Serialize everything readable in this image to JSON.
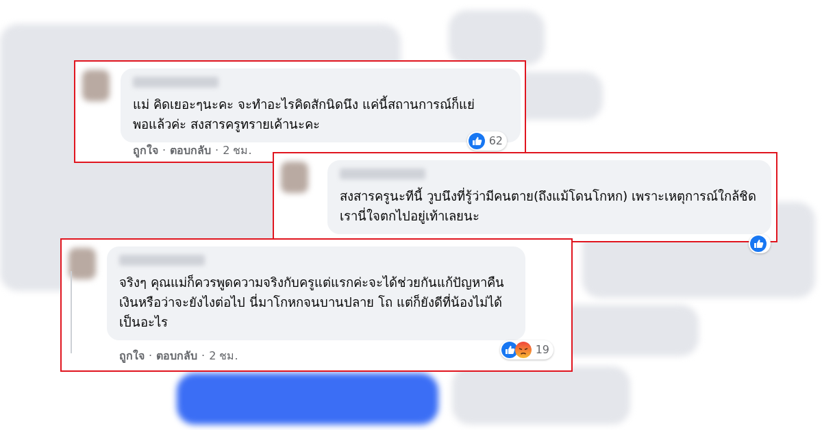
{
  "comments": [
    {
      "text": "แม่ คิดเยอะๆนะคะ จะทำอะไรคิดสักนิดนึง แค่นี้สถานการณ์ก็แย่พอแล้วค่ะ สงสารครูทรายเค้านะคะ",
      "actions": [
        "ถูกใจ",
        "ตอบกลับ"
      ],
      "separator": "·",
      "time": "2 ชม.",
      "reactions": [
        {
          "kind": "like"
        }
      ],
      "count": "62",
      "reply": false
    },
    {
      "text": "สงสารครูนะทีนี้ วูบนึงที่รู้ว่ามีคนตาย(ถึงแม้โดนโกหก) เพราะเหตุการณ์ใกล้ชิดเรานี่ใจตกไปอยู่เท้าเลยนะ",
      "reactions": [
        {
          "kind": "like"
        }
      ],
      "reply": false
    },
    {
      "text": "จริงๆ คุณแม่ก็ควรพูดความจริงกับครูแต่แรกค่ะจะได้ช่วยกันแก้ปัญหาคืนเงินหรือว่าจะยังไงต่อไป นี่มาโกหกจนบานปลาย โถ แต่ก็ยังดีที่น้องไม่ได้เป็นอะไร",
      "actions": [
        "ถูกใจ",
        "ตอบกลับ"
      ],
      "separator": "·",
      "time": "2 ชม.",
      "reactions": [
        {
          "kind": "like"
        },
        {
          "kind": "angry"
        }
      ],
      "count": "19",
      "reply": true
    }
  ]
}
